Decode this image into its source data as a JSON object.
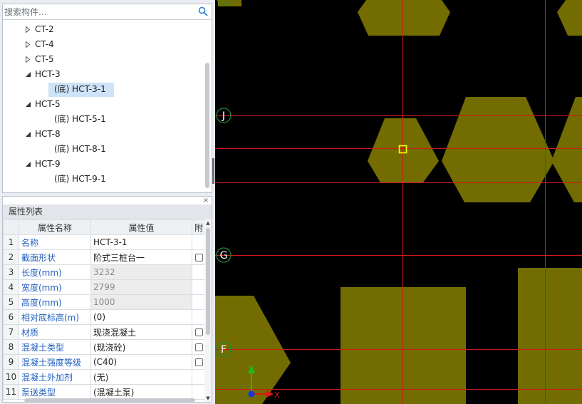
{
  "search": {
    "placeholder": "搜索构件..."
  },
  "tree": {
    "items": [
      {
        "label": "CT-2",
        "level": 1,
        "expanded": false
      },
      {
        "label": "CT-4",
        "level": 1,
        "expanded": false
      },
      {
        "label": "CT-5",
        "level": 1,
        "expanded": false
      },
      {
        "label": "HCT-3",
        "level": 1,
        "expanded": true
      },
      {
        "label": "(底) HCT-3-1",
        "level": 2,
        "selected": true
      },
      {
        "label": "HCT-5",
        "level": 1,
        "expanded": true
      },
      {
        "label": "(底) HCT-5-1",
        "level": 2
      },
      {
        "label": "HCT-8",
        "level": 1,
        "expanded": true
      },
      {
        "label": "(底) HCT-8-1",
        "level": 2
      },
      {
        "label": "HCT-9",
        "level": 1,
        "expanded": true
      },
      {
        "label": "(底) HCT-9-1",
        "level": 2
      }
    ]
  },
  "props": {
    "title": "属性列表",
    "close_glyph": "×",
    "headers": {
      "name": "属性名称",
      "value": "属性值",
      "attach": "附"
    },
    "rows": [
      {
        "num": "1",
        "name": "名称",
        "value": "HCT-3-1",
        "readonly": false,
        "check": false
      },
      {
        "num": "2",
        "name": "截面形状",
        "value": "阶式三桩台一",
        "readonly": false,
        "check": true
      },
      {
        "num": "3",
        "name": "长度(mm)",
        "value": "3232",
        "readonly": true,
        "check": false
      },
      {
        "num": "4",
        "name": "宽度(mm)",
        "value": "2799",
        "readonly": true,
        "check": false
      },
      {
        "num": "5",
        "name": "高度(mm)",
        "value": "1000",
        "readonly": true,
        "check": false
      },
      {
        "num": "6",
        "name": "相对底标高(m)",
        "value": "(0)",
        "readonly": false,
        "check": false
      },
      {
        "num": "7",
        "name": "材质",
        "value": "现浇混凝土",
        "readonly": false,
        "check": true
      },
      {
        "num": "8",
        "name": "混凝土类型",
        "value": "(现浇砼)",
        "readonly": false,
        "check": true
      },
      {
        "num": "9",
        "name": "混凝土强度等级",
        "value": "(C40)",
        "readonly": false,
        "check": true
      },
      {
        "num": "10",
        "name": "混凝土外加剂",
        "value": "(无)",
        "readonly": false,
        "check": false
      },
      {
        "num": "11",
        "name": "泵送类型",
        "value": "(混凝土泵)",
        "readonly": false,
        "check": false
      }
    ]
  },
  "canvas": {
    "background": "#000000",
    "gridline_color": "#d01818",
    "shape_color": "#736c00",
    "axis_labels": [
      "J",
      "G",
      "F"
    ],
    "ucs": {
      "x_label": "X",
      "y_label": "Y"
    }
  }
}
